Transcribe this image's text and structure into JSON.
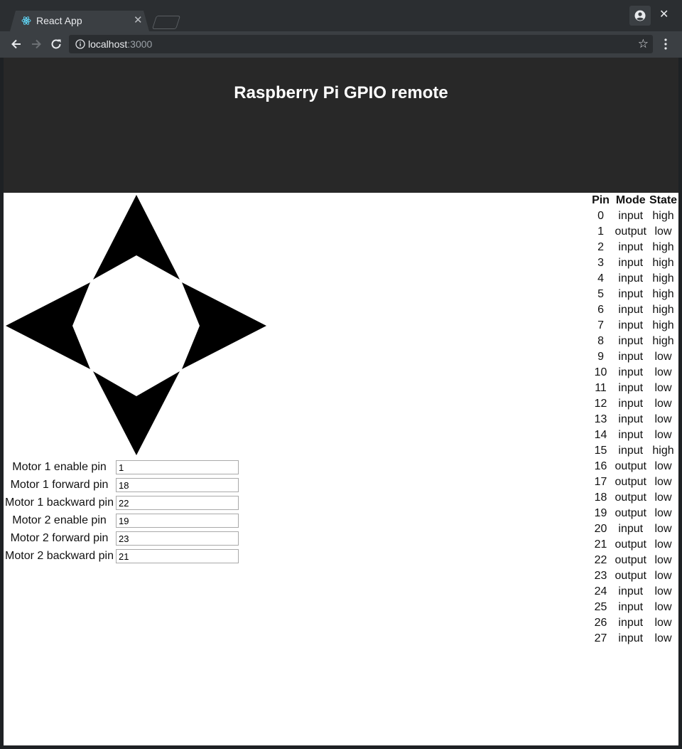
{
  "browser": {
    "tab_title": "React App",
    "url_host": "localhost",
    "url_port": ":3000"
  },
  "page": {
    "title": "Raspberry Pi GPIO remote"
  },
  "motor_config": [
    {
      "label": "Motor 1 enable pin",
      "value": "1"
    },
    {
      "label": "Motor 1 forward pin",
      "value": "18"
    },
    {
      "label": "Motor 1 backward pin",
      "value": "22"
    },
    {
      "label": "Motor 2 enable pin",
      "value": "19"
    },
    {
      "label": "Motor 2 forward pin",
      "value": "23"
    },
    {
      "label": "Motor 2 backward pin",
      "value": "21"
    }
  ],
  "gpio_table": {
    "headers": [
      "Pin",
      "Mode",
      "State"
    ],
    "rows": [
      {
        "pin": "0",
        "mode": "input",
        "state": "high"
      },
      {
        "pin": "1",
        "mode": "output",
        "state": "low"
      },
      {
        "pin": "2",
        "mode": "input",
        "state": "high"
      },
      {
        "pin": "3",
        "mode": "input",
        "state": "high"
      },
      {
        "pin": "4",
        "mode": "input",
        "state": "high"
      },
      {
        "pin": "5",
        "mode": "input",
        "state": "high"
      },
      {
        "pin": "6",
        "mode": "input",
        "state": "high"
      },
      {
        "pin": "7",
        "mode": "input",
        "state": "high"
      },
      {
        "pin": "8",
        "mode": "input",
        "state": "high"
      },
      {
        "pin": "9",
        "mode": "input",
        "state": "low"
      },
      {
        "pin": "10",
        "mode": "input",
        "state": "low"
      },
      {
        "pin": "11",
        "mode": "input",
        "state": "low"
      },
      {
        "pin": "12",
        "mode": "input",
        "state": "low"
      },
      {
        "pin": "13",
        "mode": "input",
        "state": "low"
      },
      {
        "pin": "14",
        "mode": "input",
        "state": "low"
      },
      {
        "pin": "15",
        "mode": "input",
        "state": "high"
      },
      {
        "pin": "16",
        "mode": "output",
        "state": "low"
      },
      {
        "pin": "17",
        "mode": "output",
        "state": "low"
      },
      {
        "pin": "18",
        "mode": "output",
        "state": "low"
      },
      {
        "pin": "19",
        "mode": "output",
        "state": "low"
      },
      {
        "pin": "20",
        "mode": "input",
        "state": "low"
      },
      {
        "pin": "21",
        "mode": "output",
        "state": "low"
      },
      {
        "pin": "22",
        "mode": "output",
        "state": "low"
      },
      {
        "pin": "23",
        "mode": "output",
        "state": "low"
      },
      {
        "pin": "24",
        "mode": "input",
        "state": "low"
      },
      {
        "pin": "25",
        "mode": "input",
        "state": "low"
      },
      {
        "pin": "26",
        "mode": "input",
        "state": "low"
      },
      {
        "pin": "27",
        "mode": "input",
        "state": "low"
      }
    ]
  },
  "icons": {
    "favicon": "react-icon",
    "back": "arrow-left-icon",
    "forward": "arrow-right-icon",
    "reload": "reload-icon",
    "info": "info-icon",
    "bookmark": "star-icon",
    "menu": "kebab-menu-icon",
    "profile": "account-icon",
    "close": "close-icon"
  },
  "colors": {
    "header_bg": "#282828",
    "chrome_bg": "#3b3f43",
    "arrow_fill": "#000000"
  }
}
